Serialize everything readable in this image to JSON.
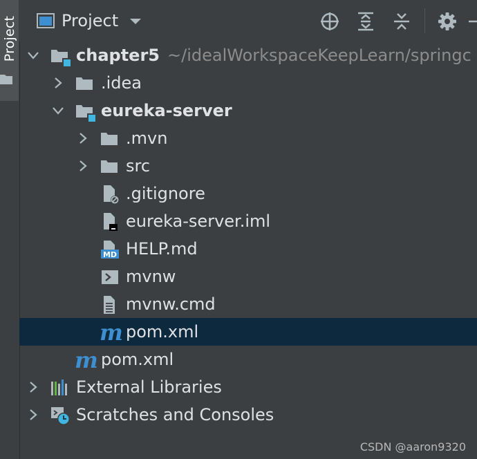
{
  "sidebar": {
    "tab_label": "Project"
  },
  "header": {
    "title": "Project",
    "toolbar": [
      "locate-icon",
      "expand-all-icon",
      "collapse-all-icon",
      "settings-icon"
    ]
  },
  "tree": {
    "root": {
      "label": "chapter5",
      "path": "~/idealWorkspaceKeepLearn/springc"
    },
    "idea": {
      "label": ".idea"
    },
    "module": {
      "label": "eureka-server"
    },
    "mvn": {
      "label": ".mvn"
    },
    "src": {
      "label": "src"
    },
    "gitignore": {
      "label": ".gitignore"
    },
    "iml": {
      "label": "eureka-server.iml"
    },
    "help": {
      "label": "HELP.md"
    },
    "mvnw": {
      "label": "mvnw"
    },
    "mvnw_cmd": {
      "label": "mvnw.cmd"
    },
    "module_pom": {
      "label": "pom.xml"
    },
    "root_pom": {
      "label": "pom.xml"
    },
    "ext_libs": {
      "label": "External Libraries"
    },
    "scratches": {
      "label": "Scratches and Consoles"
    }
  },
  "watermark": "CSDN @aaron9320",
  "colors": {
    "selected_row": "#0d293e",
    "accent": "#3e8fcf",
    "module_marker": "#40b6e0"
  }
}
